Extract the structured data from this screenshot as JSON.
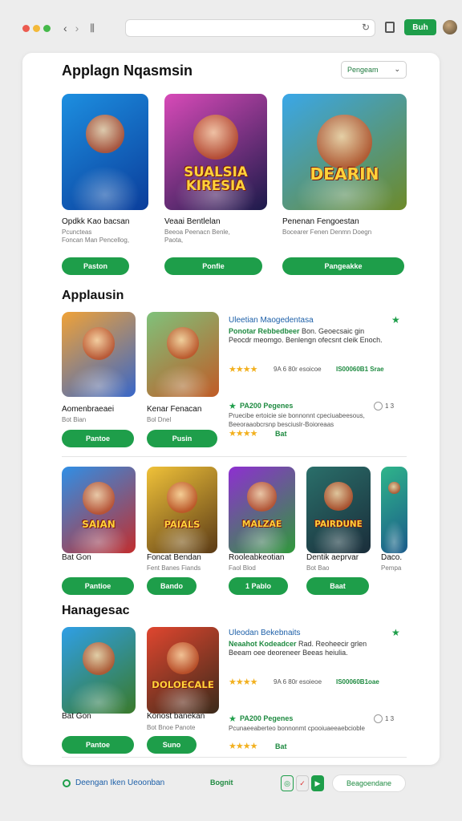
{
  "browser": {
    "back": "‹",
    "forward": "›",
    "cta_label": "Buh"
  },
  "header": {
    "title": "Applagn Nqasmsin",
    "sort_label": "Pengeam"
  },
  "featured": [
    {
      "title": "Opdkk Kao bacsan",
      "sub": "Pcuncteas",
      "meta": "Foncan Man Pencellog,",
      "button": "Paston",
      "colors": [
        "#1d8fe0",
        "#0a3d9b"
      ],
      "art_text": ""
    },
    {
      "title": "Veaai Bentlelan",
      "sub": "Beeoa Peenacn Benle,",
      "meta": "Paota,",
      "button": "Ponfie",
      "colors": [
        "#d84ab8",
        "#1b1a4a"
      ],
      "art_text": "SUALSIA KIRESIA"
    },
    {
      "title": "Penenan Fengoestan",
      "sub": "Bocearer Fenen Denmn Doegn",
      "meta": "",
      "button": "Pangeakke",
      "colors": [
        "#3aa7e8",
        "#6d8a2a"
      ],
      "art_text": "DEARIN"
    }
  ],
  "section1": {
    "title": "Applausin",
    "cards": [
      {
        "title": "Aomenbraeaei",
        "meta": "Bot Bian",
        "button": "Pantoe",
        "colors": [
          "#f0a237",
          "#3867c9"
        ]
      },
      {
        "title": "Kenar Fenacan",
        "meta": "Bol Dnel",
        "button": "Pusin",
        "colors": [
          "#7fc27b",
          "#c05b26"
        ]
      }
    ],
    "detail": {
      "title": "Uleetian Maogedentasa",
      "sub_lead": "Ponotar Rebbedbeer",
      "sub": "Bon. Geoecsaic gin Peocdr meomgo. Benlengn ofecsnt cleik Enoch.",
      "rating_text": "9A 6 80r esoicoe",
      "rating_green": "IS00060B1 Srae",
      "features": "PA200 Pegenes",
      "feature_count": "1 3",
      "feature_desc": "Pruecibe ertoicie sie bonnonnt cpeciuabeesous, Beeoraaobcrsnp besciuslr-Boioreaas",
      "bat_label": "Bat"
    }
  },
  "section2": {
    "cards": [
      {
        "title": "Bat Gon",
        "meta": "",
        "button": "Pantioe",
        "colors": [
          "#2f8fe6",
          "#c22e2e"
        ],
        "art_text": "SAIAN"
      },
      {
        "title": "Foncat Bendan",
        "meta": "Fent Banes Fiands",
        "button": "Bando",
        "colors": [
          "#f0c239",
          "#5a3a16"
        ],
        "art_text": "PAIALS"
      },
      {
        "title": "Rooleabkeotian",
        "meta": "Faol Blod",
        "button": "1 Pablo",
        "colors": [
          "#8e2fd1",
          "#2f9a3a"
        ],
        "art_text": "MALZAE"
      },
      {
        "title": "Dentik aeprvar",
        "meta": "Bot Bao",
        "button": "Baat",
        "colors": [
          "#2a6f6a",
          "#1a2d3a"
        ],
        "art_text": "PAIRDUNE"
      },
      {
        "title": "Daco.",
        "meta": "Pempa",
        "button": "",
        "colors": [
          "#2fb58a",
          "#1a5a8a"
        ],
        "art_text": ""
      }
    ]
  },
  "section3": {
    "title": "Hanagesac",
    "cards": [
      {
        "title": "Bat Gon",
        "meta": "",
        "button": "Pantoe",
        "colors": [
          "#2f9fe6",
          "#3a7a2a"
        ],
        "art_text": ""
      },
      {
        "title": "Konost banekan",
        "meta": "Bot Bnoe Panote",
        "button": "Suno",
        "colors": [
          "#e0462f",
          "#3a2a1a"
        ],
        "art_text": "DOLOECALE"
      }
    ],
    "detail": {
      "title": "Uleodan Bekebnaits",
      "sub_lead": "Neaahot Kodeadcer",
      "sub": "Rad. Reoheecir grlen Beeam oee deoreneer Beeas heiulia.",
      "rating_text": "9A 6 80r esoieoe",
      "rating_green": "IS00060B1oae",
      "features": "PA200 Pegenes",
      "feature_count": "1 3",
      "feature_desc": "Pcunaeeaberteo bonnonmt cpooiuaeeaebcioble",
      "bat_label": "Bat"
    }
  },
  "footer": {
    "label": "Deengan Iken Ueoonban",
    "mid": "Bognit",
    "button": "Beagoendane"
  }
}
